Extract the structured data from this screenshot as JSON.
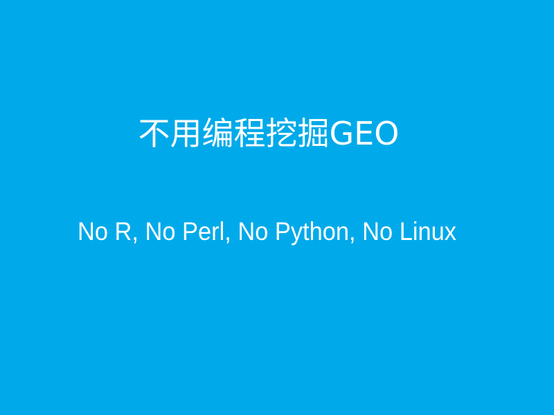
{
  "slide": {
    "title": "不用编程挖掘GEO",
    "subtitle": "No R, No Perl, No Python, No Linux"
  },
  "colors": {
    "background": "#00aaea",
    "text": "#ffffff"
  }
}
